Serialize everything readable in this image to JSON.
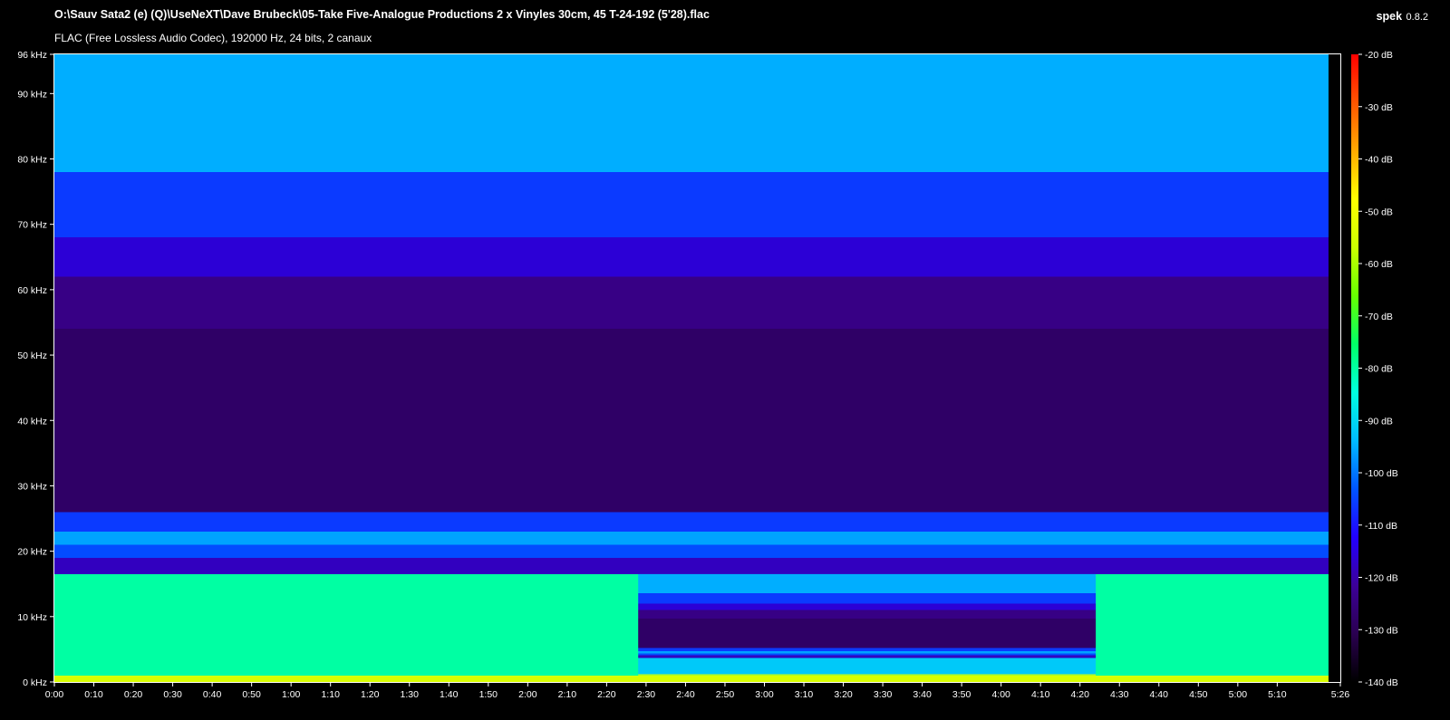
{
  "header": {
    "file_title": "O:\\Sauv Sata2 (e) (Q)\\UseNeXT\\Dave Brubeck\\05-Take Five-Analogue Productions 2 x Vinyles 30cm, 45 T-24-192 (5'28).flac",
    "codec_info": "FLAC (Free Lossless Audio Codec), 192000 Hz, 24 bits, 2 canaux",
    "app_name": "spek",
    "app_version": "0.8.2"
  },
  "chart_data": {
    "type": "heatmap",
    "title": "",
    "xlabel": "",
    "ylabel": "",
    "x_range_seconds": [
      0,
      326
    ],
    "y_range_khz": [
      0,
      96
    ],
    "x_ticks": [
      {
        "t": 0,
        "label": "0:00"
      },
      {
        "t": 10,
        "label": "0:10"
      },
      {
        "t": 20,
        "label": "0:20"
      },
      {
        "t": 30,
        "label": "0:30"
      },
      {
        "t": 40,
        "label": "0:40"
      },
      {
        "t": 50,
        "label": "0:50"
      },
      {
        "t": 60,
        "label": "1:00"
      },
      {
        "t": 70,
        "label": "1:10"
      },
      {
        "t": 80,
        "label": "1:20"
      },
      {
        "t": 90,
        "label": "1:30"
      },
      {
        "t": 100,
        "label": "1:40"
      },
      {
        "t": 110,
        "label": "1:50"
      },
      {
        "t": 120,
        "label": "2:00"
      },
      {
        "t": 130,
        "label": "2:10"
      },
      {
        "t": 140,
        "label": "2:20"
      },
      {
        "t": 150,
        "label": "2:30"
      },
      {
        "t": 160,
        "label": "2:40"
      },
      {
        "t": 170,
        "label": "2:50"
      },
      {
        "t": 180,
        "label": "3:00"
      },
      {
        "t": 190,
        "label": "3:10"
      },
      {
        "t": 200,
        "label": "3:20"
      },
      {
        "t": 210,
        "label": "3:30"
      },
      {
        "t": 220,
        "label": "3:40"
      },
      {
        "t": 230,
        "label": "3:50"
      },
      {
        "t": 240,
        "label": "4:00"
      },
      {
        "t": 250,
        "label": "4:10"
      },
      {
        "t": 260,
        "label": "4:20"
      },
      {
        "t": 270,
        "label": "4:30"
      },
      {
        "t": 280,
        "label": "4:40"
      },
      {
        "t": 290,
        "label": "4:50"
      },
      {
        "t": 300,
        "label": "5:00"
      },
      {
        "t": 310,
        "label": "5:10"
      },
      {
        "t": 326,
        "label": "5:26"
      }
    ],
    "y_ticks": [
      {
        "v": 0,
        "label": "0 kHz"
      },
      {
        "v": 10,
        "label": "10 kHz"
      },
      {
        "v": 20,
        "label": "20 kHz"
      },
      {
        "v": 30,
        "label": "30 kHz"
      },
      {
        "v": 40,
        "label": "40 kHz"
      },
      {
        "v": 50,
        "label": "50 kHz"
      },
      {
        "v": 60,
        "label": "60 kHz"
      },
      {
        "v": 70,
        "label": "70 kHz"
      },
      {
        "v": 80,
        "label": "80 kHz"
      },
      {
        "v": 90,
        "label": "90 kHz"
      },
      {
        "v": 96,
        "label": "96 kHz"
      }
    ],
    "color_scale_db": [
      -140,
      -20
    ],
    "color_ticks": [
      {
        "v": -20,
        "label": "-20 dB"
      },
      {
        "v": -30,
        "label": "-30 dB"
      },
      {
        "v": -40,
        "label": "-40 dB"
      },
      {
        "v": -50,
        "label": "-50 dB"
      },
      {
        "v": -60,
        "label": "-60 dB"
      },
      {
        "v": -70,
        "label": "-70 dB"
      },
      {
        "v": -80,
        "label": "-80 dB"
      },
      {
        "v": -90,
        "label": "-90 dB"
      },
      {
        "v": -100,
        "label": "-100 dB"
      },
      {
        "v": -110,
        "label": "-110 dB"
      },
      {
        "v": -120,
        "label": "-120 dB"
      },
      {
        "v": -130,
        "label": "-130 dB"
      },
      {
        "v": -140,
        "label": "-140 dB"
      }
    ],
    "colormap": [
      "#000000",
      "#2a0050",
      "#3c0098",
      "#2200ff",
      "#0055ff",
      "#00bbff",
      "#00ffe0",
      "#00ff66",
      "#66ff00",
      "#ccff00",
      "#ffff00",
      "#ffaa00",
      "#ff5500",
      "#ff0000"
    ],
    "frequency_bands_khz": [
      {
        "from": 0,
        "to": 1,
        "db": -55
      },
      {
        "from": 1,
        "to": 16.5,
        "db": -80
      },
      {
        "from": 16.5,
        "to": 19,
        "db": -118
      },
      {
        "from": 19,
        "to": 21,
        "db": -104
      },
      {
        "from": 21,
        "to": 23,
        "db": -96
      },
      {
        "from": 23,
        "to": 26,
        "db": -106
      },
      {
        "from": 26,
        "to": 54,
        "db": -128
      },
      {
        "from": 54,
        "to": 62,
        "db": -124
      },
      {
        "from": 62,
        "to": 68,
        "db": -116
      },
      {
        "from": 68,
        "to": 78,
        "db": -106
      },
      {
        "from": 78,
        "to": 96,
        "db": -95
      }
    ],
    "quiet_segments_seconds": [
      [
        148,
        264
      ]
    ],
    "end_of_audio_seconds": 323
  }
}
